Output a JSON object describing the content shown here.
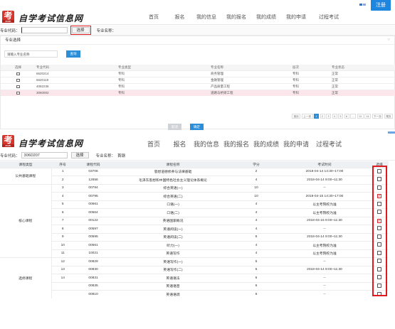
{
  "header": {
    "register_label": "注册",
    "site_title": "自学考试信息网",
    "logo_badge": "ZGZK",
    "nav": [
      "首页",
      "报名",
      "我的信息",
      "我的报名",
      "我的成绩",
      "我的申请",
      "过程考试"
    ]
  },
  "top_form": {
    "code_label": "专业代码：",
    "code_value": "",
    "select_label": "选择",
    "name_label": "专业名称："
  },
  "modal": {
    "title": "专业选择",
    "close_icon": "close-icon",
    "search_placeholder": "请输入专业名称",
    "search_button": "查询",
    "columns": [
      "选择",
      "专业代码",
      "专业类型",
      "专业名称",
      "层次",
      "专业状态"
    ],
    "rows": [
      {
        "code": "6620214",
        "type": "专科",
        "name": "商务管理",
        "level": "专科",
        "status": "正常"
      },
      {
        "code": "6620119",
        "type": "专科",
        "name": "金融管理",
        "level": "专科",
        "status": "正常"
      },
      {
        "code": "4082236",
        "type": "专科",
        "name": "产品质量工程",
        "level": "专科",
        "status": "正常"
      },
      {
        "code": "3060002",
        "type": "专科",
        "name": "道路与桥梁工程",
        "level": "专科",
        "status": "正常"
      }
    ],
    "pager": [
      "首页",
      "上一页",
      "1",
      "2",
      "3",
      "4",
      "5",
      "6",
      "...",
      "13",
      "14",
      "下一页",
      "尾页"
    ],
    "pager_active": "1",
    "cancel_label": "取消",
    "confirm_label": "确定"
  },
  "bottom_form": {
    "code_label": "专业代码：",
    "code_value": "306D207",
    "select_label": "选择",
    "name_label": "专业名称：",
    "name_value": "首钢"
  },
  "course_table": {
    "columns": [
      "课程类型",
      "序号",
      "课程代码",
      "课程名称",
      "学分",
      "考试时间",
      "选择"
    ],
    "groups": [
      {
        "label": "公共基础课程",
        "rows": [
          {
            "seq": "1",
            "code": "03706",
            "name": "思想道德修养与法律基础",
            "credit": "2",
            "time": "2018-04-14 14:30~17:00",
            "checked": false
          },
          {
            "seq": "2",
            "code": "12656",
            "name": "毛泽东思想和中国特色社会主义理论体系概论",
            "credit": "4",
            "time": "2018-04-14 9:00~11:30",
            "checked": false
          }
        ]
      },
      {
        "label": "核心课程",
        "rows": [
          {
            "seq": "3",
            "code": "00794",
            "name": "综合英语(一)",
            "credit": "10",
            "time": "--",
            "checked": false
          },
          {
            "seq": "4",
            "code": "00795",
            "name": "综合英语(二)",
            "credit": "10",
            "time": "2018-04-15 14:30~17:00",
            "checked": true
          },
          {
            "seq": "5",
            "code": "00561",
            "name": "口语(一)",
            "credit": "4",
            "time": "以主考院校为准",
            "checked": false
          },
          {
            "seq": "6",
            "code": "00564",
            "name": "口语(二)",
            "credit": "4",
            "time": "以主考院校为准",
            "checked": false
          },
          {
            "seq": "7",
            "code": "00122",
            "name": "英语国家概况",
            "credit": "4",
            "time": "2018-04-15 9:00~11:30",
            "checked": true
          },
          {
            "seq": "8",
            "code": "00597",
            "name": "英语阅读(一)",
            "credit": "4",
            "time": "--",
            "checked": false
          },
          {
            "seq": "9",
            "code": "00595",
            "name": "英语阅读(二)",
            "credit": "6",
            "time": "2018-04-14 9:00~11:30",
            "checked": false
          },
          {
            "seq": "10",
            "code": "00561",
            "name": "听力(一)",
            "credit": "4",
            "time": "以主考院校为准",
            "checked": false
          },
          {
            "seq": "11",
            "code": "10021",
            "name": "英语写作",
            "credit": "4",
            "time": "以主考院校为准",
            "checked": false
          }
        ]
      },
      {
        "label": "选修课程",
        "rows": [
          {
            "seq": "12",
            "code": "00829",
            "name": "英语写作(一)",
            "credit": "6",
            "time": "--",
            "checked": false
          },
          {
            "seq": "13",
            "code": "00830",
            "name": "英语写作(二)",
            "credit": "6",
            "time": "2018-04-14 9:00~11:30",
            "checked": false
          },
          {
            "seq": "14",
            "code": "00831",
            "name": "英语语法",
            "credit": "6",
            "time": "--",
            "checked": false
          },
          {
            "seq": "",
            "code": "00835",
            "name": "英语语音",
            "credit": "6",
            "time": "--",
            "checked": false
          },
          {
            "seq": "",
            "code": "00810",
            "name": "英语语调",
            "credit": "6",
            "time": "--",
            "checked": false
          }
        ]
      }
    ]
  }
}
